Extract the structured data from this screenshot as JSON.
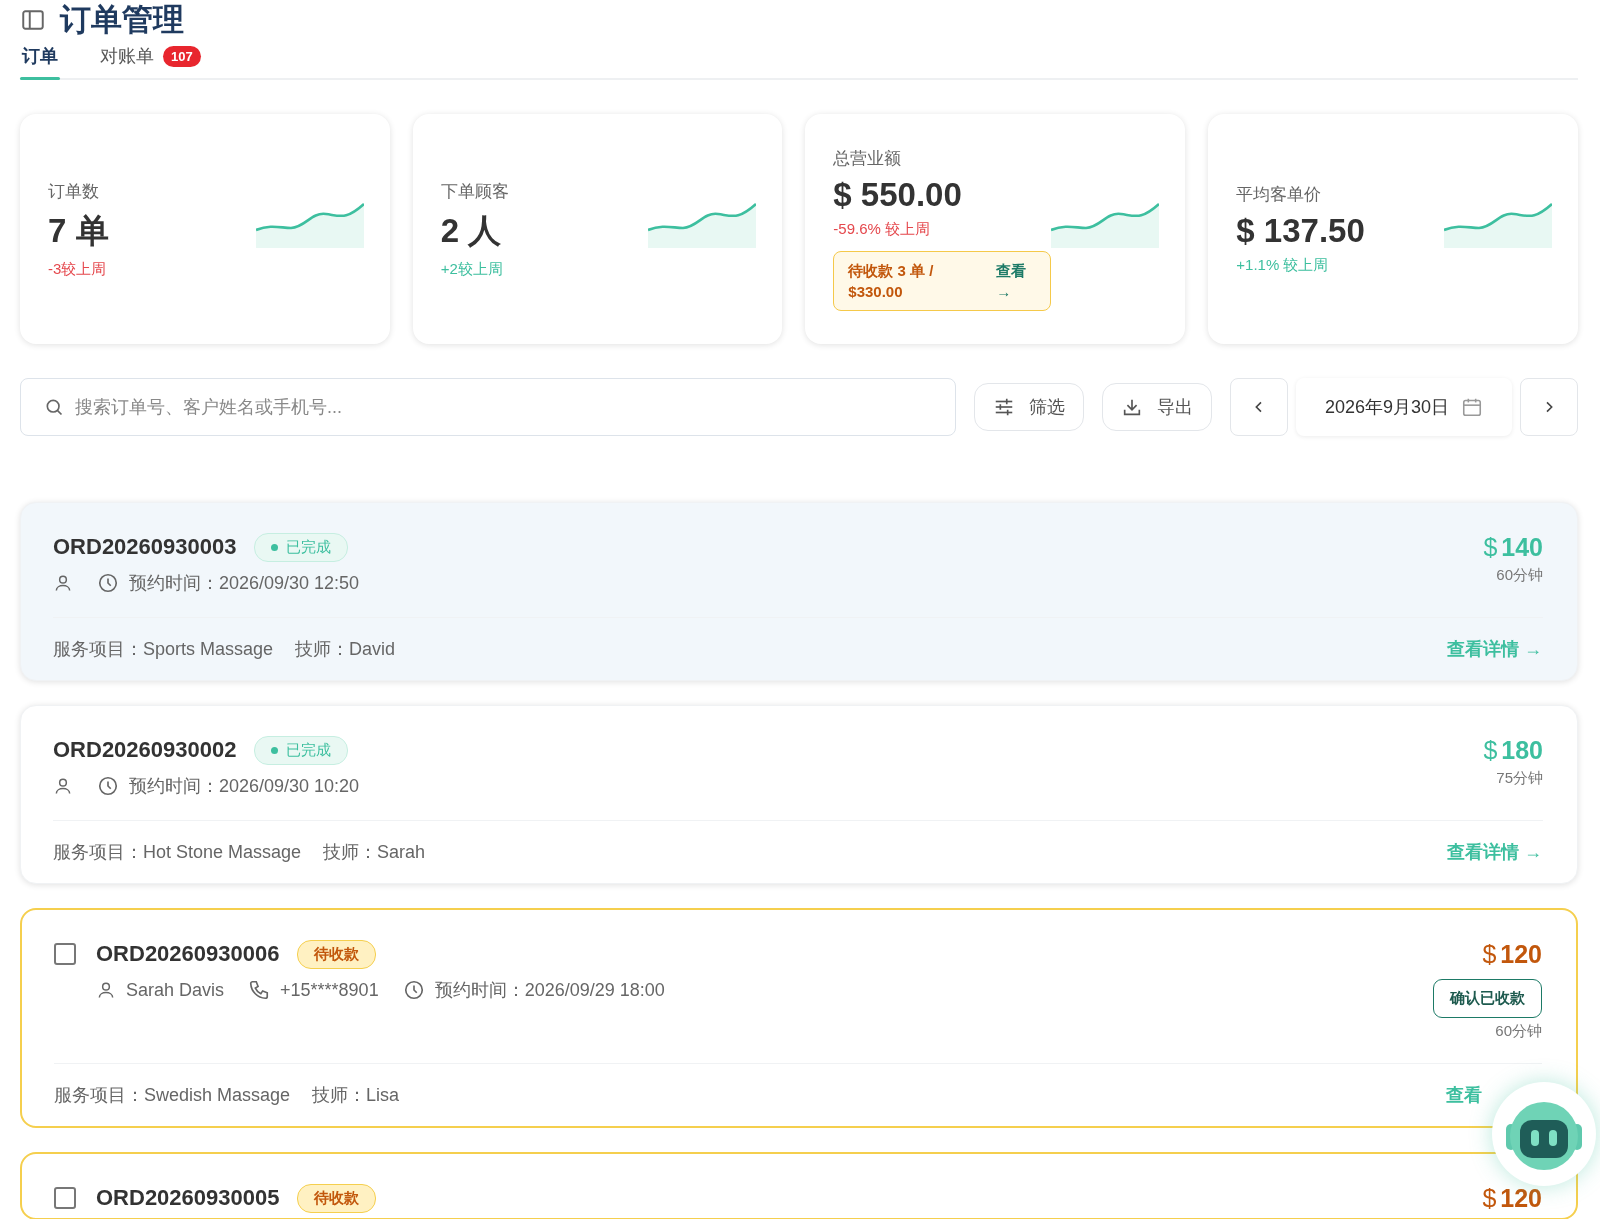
{
  "page": {
    "title": "订单管理"
  },
  "tabs": [
    {
      "label": "订单",
      "selected": true
    },
    {
      "label": "对账单",
      "selected": false,
      "badge": "107"
    }
  ],
  "stats": [
    {
      "label": "订单数",
      "value": "7 单",
      "change": "-3较上周",
      "negative": true
    },
    {
      "label": "下单顾客",
      "value": "2 人",
      "change": "+2较上周",
      "negative": false
    },
    {
      "label": "总营业额",
      "value": "$ 550.00",
      "change": "-59.6% 较上周",
      "negative": true,
      "pending": {
        "text": "待收款 3 单 / $330.00",
        "link": "查看 →"
      }
    },
    {
      "label": "平均客单价",
      "value": "$ 137.50",
      "change": "+1.1% 较上周",
      "negative": false
    }
  ],
  "toolbar": {
    "search": {
      "placeholder": "搜索订单号、客户姓名或手机号..."
    },
    "filter": "筛选",
    "export": "导出",
    "date": "2026年9月30日"
  },
  "orders": [
    {
      "id": "ORD20260930003",
      "status": "已完成",
      "kind": "done",
      "highlighted": true,
      "time": "预约时间：2026/09/30 12:50",
      "currency": "$",
      "price": "140",
      "duration": "60分钟",
      "service": "服务项目：Sports Massage",
      "technician": "技师：David",
      "link": "查看详情 →"
    },
    {
      "id": "ORD20260930002",
      "status": "已完成",
      "kind": "done",
      "highlighted": false,
      "time": "预约时间：2026/09/30 10:20",
      "currency": "$",
      "price": "180",
      "duration": "75分钟",
      "service": "服务项目：Hot Stone Massage",
      "technician": "技师：Sarah",
      "link": "查看详情 →"
    },
    {
      "id": "ORD20260930006",
      "status": "待收款",
      "kind": "pending",
      "highlighted": false,
      "checked": false,
      "customer": "Sarah Davis",
      "phone": "+15****8901",
      "time": "预约时间：2026/09/29 18:00",
      "currency": "$",
      "price": "120",
      "action": "确认已收款",
      "duration": "60分钟",
      "service": "服务项目：Swedish Massage",
      "technician": "技师：Lisa",
      "link": "查看"
    },
    {
      "id": "ORD20260930005",
      "status": "待收款",
      "kind": "pending",
      "highlighted": false,
      "checked": false,
      "currency": "$",
      "price": "120"
    }
  ]
}
